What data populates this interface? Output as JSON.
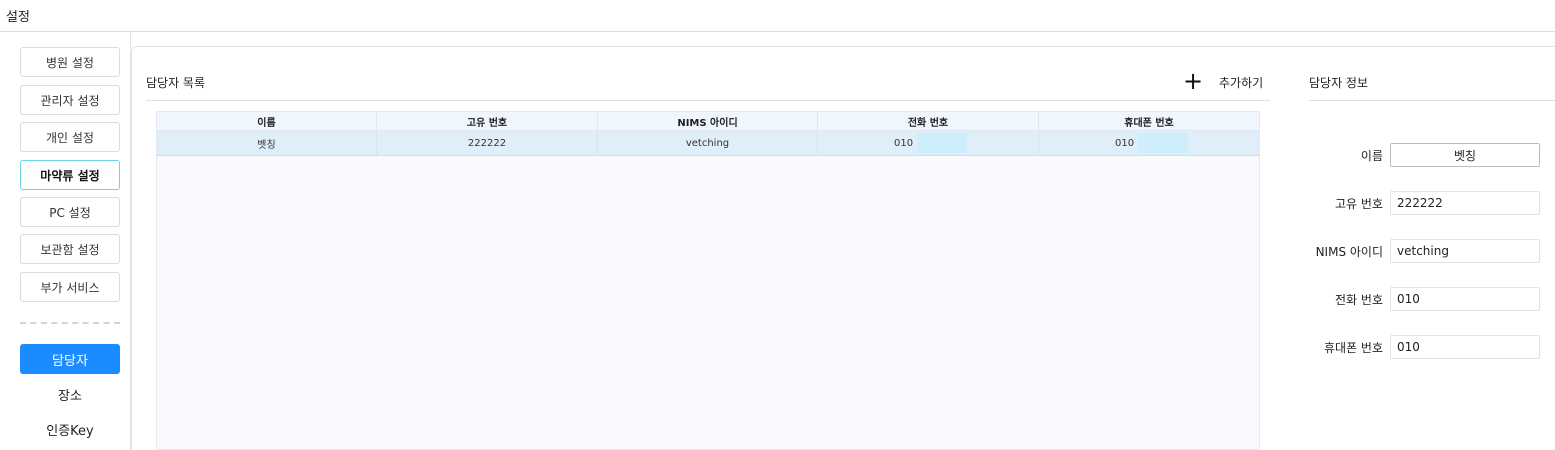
{
  "app": {
    "title": "설정"
  },
  "sidebar": {
    "settings": [
      {
        "label": "병원 설정",
        "active": false
      },
      {
        "label": "관리자 설정",
        "active": false
      },
      {
        "label": "개인 설정",
        "active": false
      },
      {
        "label": "마약류 설정",
        "active": true
      },
      {
        "label": "PC 설정",
        "active": false
      },
      {
        "label": "보관함 설정",
        "active": false
      },
      {
        "label": "부가 서비스",
        "active": false
      }
    ],
    "tabs": [
      {
        "label": "담당자",
        "active": true
      },
      {
        "label": "장소",
        "active": false
      },
      {
        "label": "인증Key",
        "active": false
      }
    ]
  },
  "list": {
    "title": "담당자 목록",
    "add_label": "추가하기",
    "columns": [
      "이름",
      "고유 번호",
      "NIMS 아이디",
      "전화 번호",
      "휴대폰 번호"
    ],
    "rows": [
      {
        "name": "벳칭",
        "unique_no": "222222",
        "nims_id": "vetching",
        "phone": "010",
        "mobile": "010"
      }
    ]
  },
  "info": {
    "title": "담당자 정보",
    "fields": {
      "name": {
        "label": "이름",
        "value": "벳칭"
      },
      "unique_no": {
        "label": "고유 번호",
        "value": "222222"
      },
      "nims_id": {
        "label": "NIMS 아이디",
        "value": "vetching"
      },
      "phone": {
        "label": "전화 번호",
        "value": "010"
      },
      "mobile": {
        "label": "휴대폰 번호",
        "value": "010"
      }
    }
  },
  "colors": {
    "accent": "#1a8cff",
    "active_border": "#66d6e4",
    "row_selected": "#dfeef9",
    "header_bg": "#f0f6fd"
  }
}
